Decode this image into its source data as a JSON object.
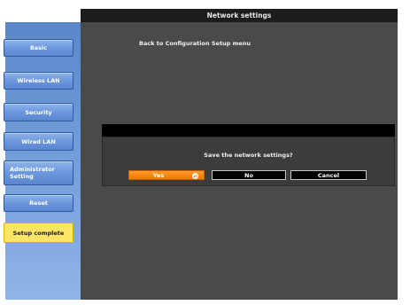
{
  "header": {
    "title": "Network settings"
  },
  "sidebar": {
    "items": [
      {
        "label": "Basic"
      },
      {
        "label": "Wireless LAN"
      },
      {
        "label": "Security"
      },
      {
        "label": "Wired LAN"
      },
      {
        "label_line1": "Administrator",
        "label_line2": "Setting"
      },
      {
        "label": "Reset"
      },
      {
        "label": "Setup complete",
        "active": true
      }
    ]
  },
  "main": {
    "back_link": "Back to Configuration Setup menu"
  },
  "dialog": {
    "message": "Save the network settings?",
    "buttons": {
      "yes": "Yes",
      "no": "No",
      "cancel": "Cancel"
    },
    "enter_icon": "enter-icon"
  },
  "colors": {
    "sidebar_blue": "#6c97dd",
    "active_yellow": "#ffe566",
    "selected_orange": "#ee7a00",
    "panel_gray": "#4a4a4a"
  }
}
